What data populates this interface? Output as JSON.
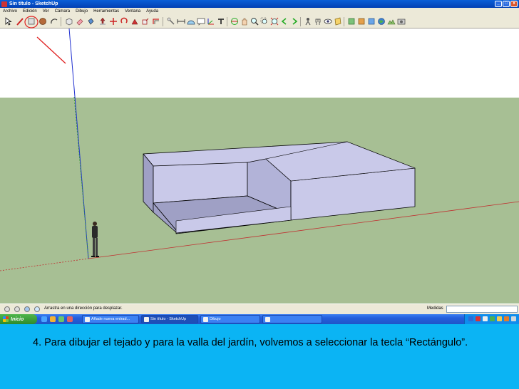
{
  "window": {
    "title": "Sin título - SketchUp",
    "buttons": {
      "minimize": "_",
      "maximize": "□",
      "close": "x"
    }
  },
  "menu": {
    "items": [
      "Archivo",
      "Edición",
      "Ver",
      "Cámara",
      "Dibujo",
      "Herramientas",
      "Ventana",
      "Ayuda"
    ]
  },
  "toolbar": {
    "tools": [
      "select-icon",
      "line-icon",
      "rectangle-icon",
      "circle-icon",
      "arc-icon",
      "make-component-icon",
      "eraser-icon",
      "paint-bucket-icon",
      "push-pull-icon",
      "move-icon",
      "rotate-icon",
      "follow-me-icon",
      "scale-icon",
      "offset-icon",
      "tape-measure-icon",
      "dimension-icon",
      "protractor-icon",
      "text-icon",
      "axes-icon",
      "3d-text-icon",
      "orbit-icon",
      "pan-icon",
      "zoom-icon",
      "zoom-window-icon",
      "zoom-extents-icon",
      "previous-view-icon",
      "next-view-icon",
      "position-camera-icon",
      "walk-icon",
      "look-around-icon",
      "section-plane-icon",
      "get-models-icon",
      "share-model-icon",
      "share-component-icon",
      "google-earth-icon",
      "toggle-terrain-icon",
      "photo-textures-icon"
    ],
    "highlighted_tool": "rectangle-icon",
    "annotation_color": "#e02020"
  },
  "viewport": {
    "sky_color": "#ffffff",
    "ground_color": "#a7bf94",
    "model_face_color": "#c9c9e9",
    "model_shadow_color": "#9fa0c5",
    "axis_colors": {
      "red": "#c03030",
      "green": "#2f9a2f",
      "blue": "#2030d0"
    }
  },
  "statusbar": {
    "hint": "Arrastra en una dirección para desplazar.",
    "measurements_label": "Medidas",
    "measurements_value": ""
  },
  "taskbar": {
    "start_label": "Inicio",
    "tasks": [
      {
        "label": "Añade nueva entrad...",
        "active": false
      },
      {
        "label": "Sin título - SketchUp",
        "active": true
      },
      {
        "label": "Dibujo",
        "active": false
      },
      {
        "label": "",
        "active": false
      }
    ]
  },
  "caption": {
    "text": "4. Para dibujar el tejado y para la valla del jardín, volvemos a seleccionar la tecla “Rectángulo”."
  }
}
